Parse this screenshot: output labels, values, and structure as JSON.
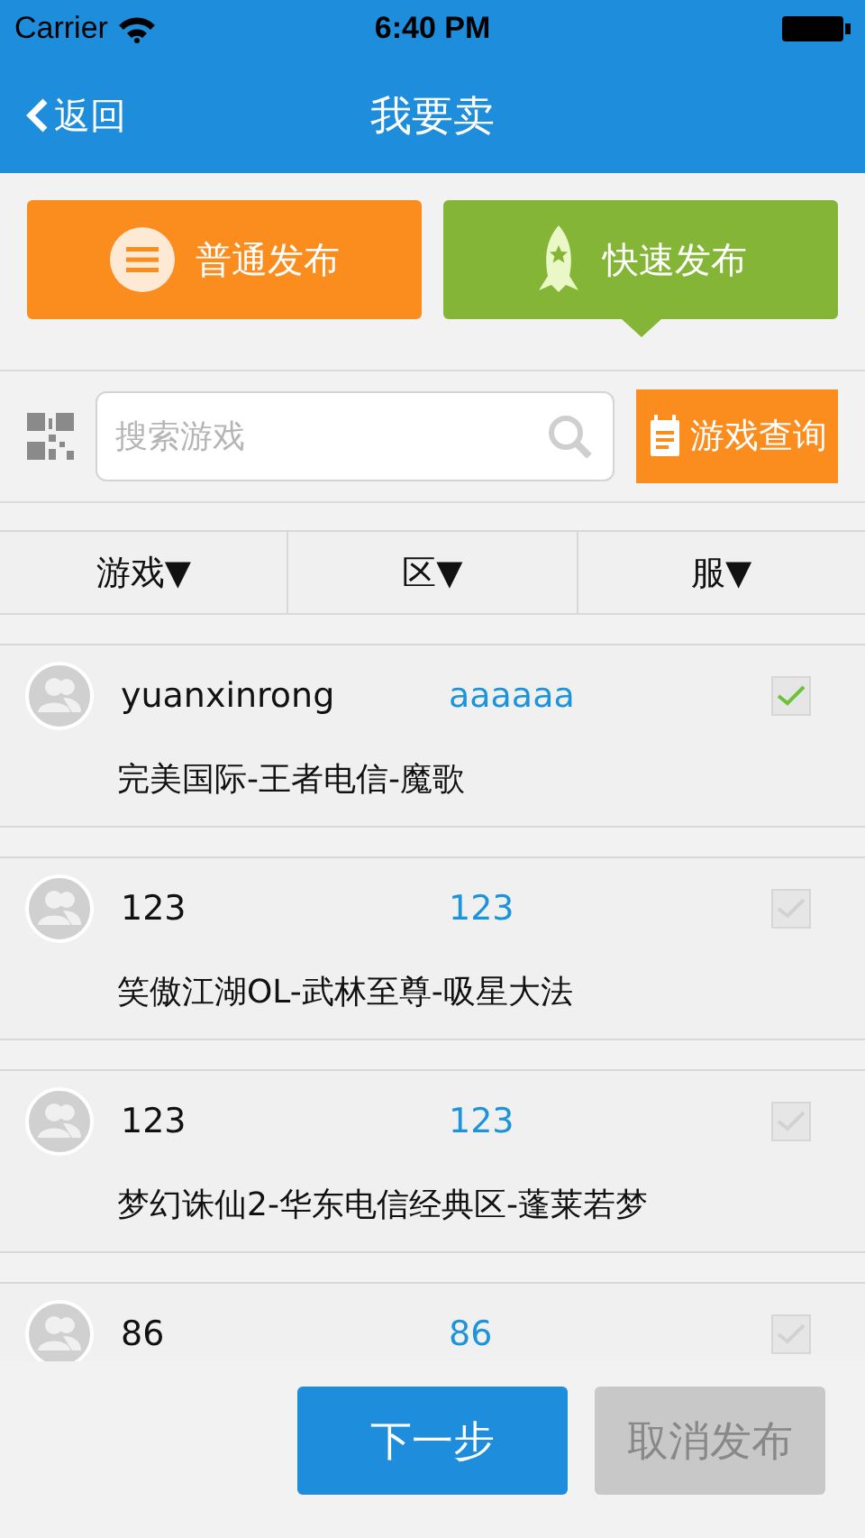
{
  "status_bar": {
    "carrier": "Carrier",
    "time": "6:40 PM"
  },
  "nav": {
    "back": "返回",
    "title": "我要卖"
  },
  "publish_modes": [
    {
      "kind": "list",
      "label": "普通发布",
      "selected": false
    },
    {
      "kind": "rocket",
      "label": "快速发布",
      "selected": true
    }
  ],
  "search": {
    "placeholder": "搜索游戏",
    "query_button": "游戏查询"
  },
  "filters": [
    "游戏▼",
    "区▼",
    "服▼"
  ],
  "items": [
    {
      "name": "yuanxinrong",
      "region": "aaaaaa",
      "checked": true,
      "description": "完美国际-王者电信-魔歌"
    },
    {
      "name": "123",
      "region": "123",
      "checked": false,
      "description": "笑傲江湖OL-武林至尊-吸星大法"
    },
    {
      "name": "123",
      "region": "123",
      "checked": false,
      "description": "梦幻诛仙2-华东电信经典区-蓬莱若梦"
    },
    {
      "name": "86",
      "region": "86",
      "checked": false
    }
  ],
  "buttons": [
    {
      "kind": "primary",
      "label": "下一步"
    },
    {
      "kind": "secondary",
      "label": "取消发布"
    }
  ]
}
